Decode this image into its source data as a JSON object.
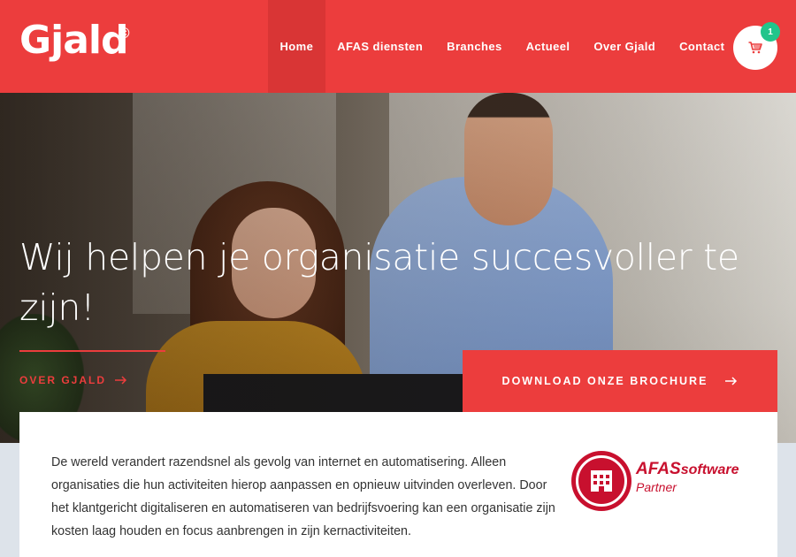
{
  "header": {
    "logo": "Gjald",
    "logo_mark": "©",
    "nav": [
      {
        "label": "Home",
        "active": true
      },
      {
        "label": "AFAS diensten"
      },
      {
        "label": "Branches"
      },
      {
        "label": "Actueel"
      },
      {
        "label": "Over Gjald"
      },
      {
        "label": "Contact"
      }
    ],
    "cart_count": "1",
    "cart_icon": "shopping-cart-icon"
  },
  "hero": {
    "headline": "Wij helpen je organisatie succesvoller te zijn!",
    "over_link": "OVER GJALD",
    "cta": "DOWNLOAD ONZE BROCHURE",
    "arrow_icon": "arrow-right-icon"
  },
  "intro": {
    "text": "De wereld verandert razendsnel als gevolg van internet en automatisering. Alleen organisaties die hun activiteiten hierop aanpassen en opnieuw uitvinden overleven. Door het klantgericht digitaliseren en automatiseren van bedrijfsvoering kan een organisatie zijn kosten laag houden en focus aanbrengen in zijn kernactiviteiten."
  },
  "partner": {
    "brand": "AFAS",
    "brand_suffix": "software",
    "label": "Partner"
  },
  "colors": {
    "brand_red": "#ec3d3d",
    "badge_green": "#22c58b",
    "afas_red": "#c8102e"
  }
}
